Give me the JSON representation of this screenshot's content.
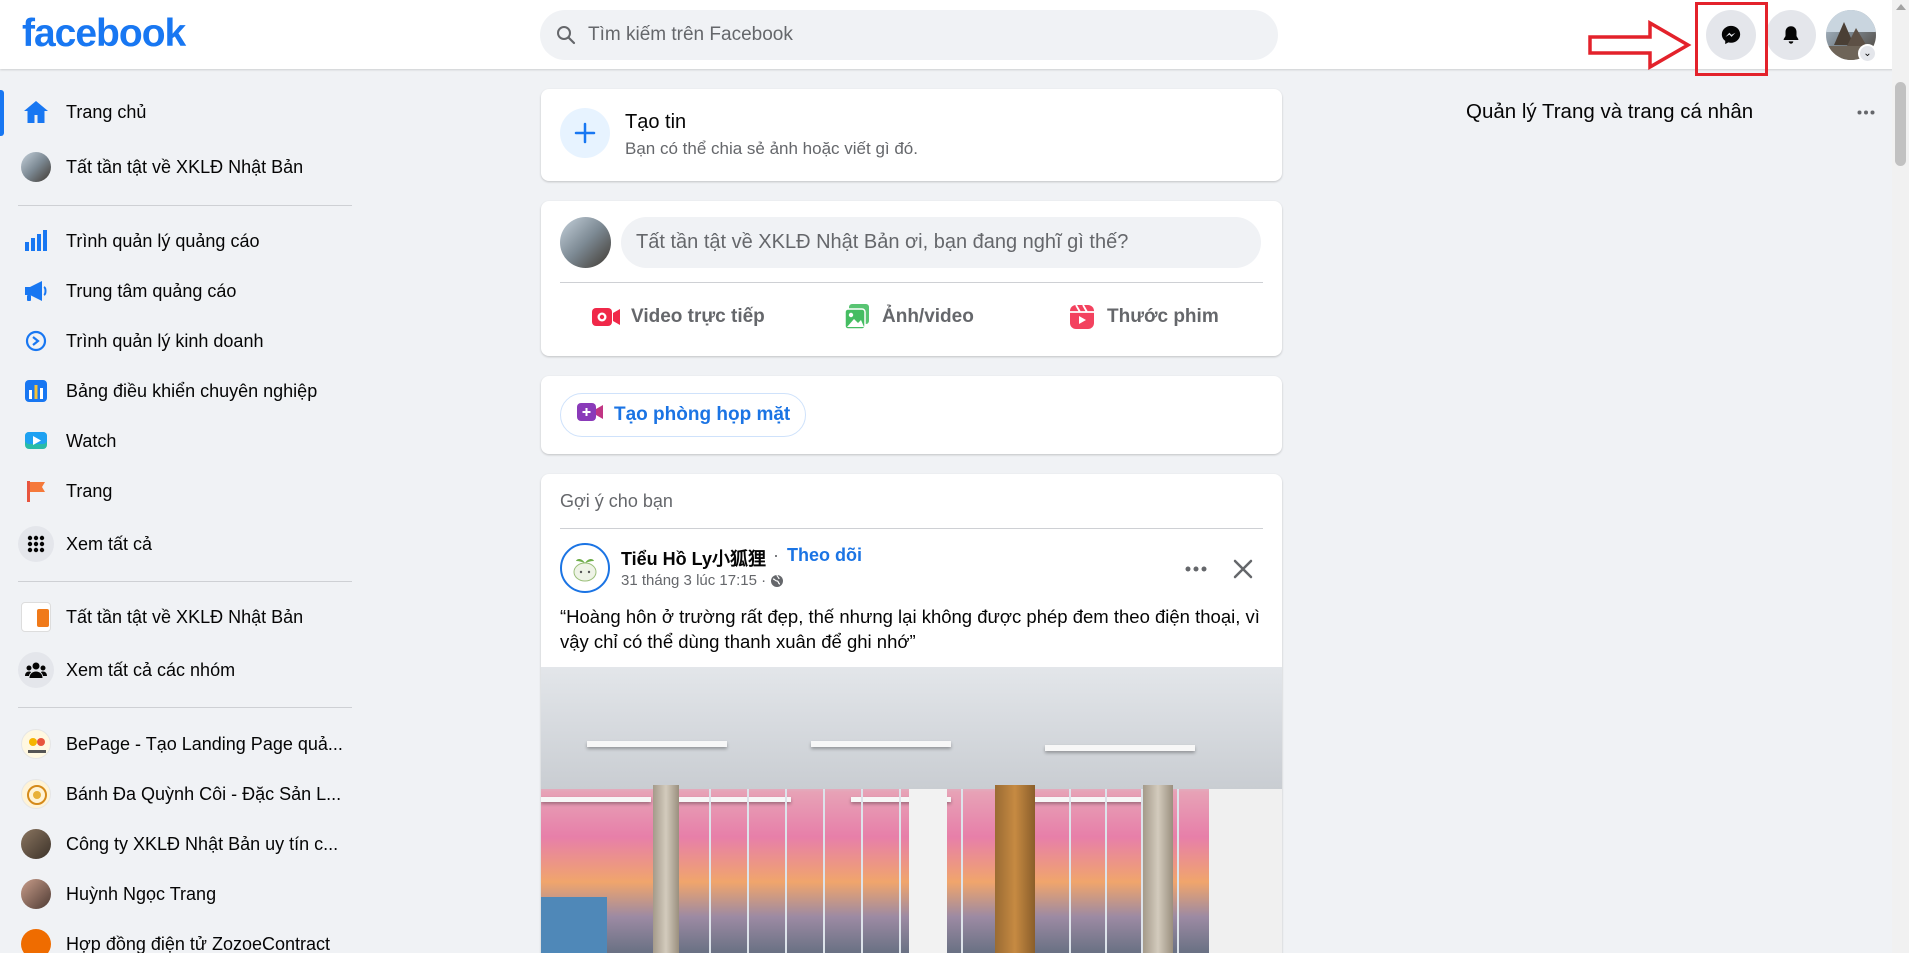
{
  "header": {
    "logo": "facebook",
    "search_placeholder": "Tìm kiếm trên Facebook",
    "icons": [
      "messenger-icon",
      "notification-bell-icon",
      "profile-avatar"
    ]
  },
  "sidebar": {
    "items": [
      {
        "label": "Trang chủ",
        "icon": "home-icon",
        "active": true
      },
      {
        "label": "Tất tần tật về XKLĐ Nhật Bản",
        "icon": "profile-avatar"
      },
      {
        "label": "Trình quản lý quảng cáo",
        "icon": "ads-manager-icon"
      },
      {
        "label": "Trung tâm quảng cáo",
        "icon": "megaphone-icon"
      },
      {
        "label": "Trình quản lý kinh doanh",
        "icon": "business-manager-icon"
      },
      {
        "label": "Bảng điều khiển chuyên nghiệp",
        "icon": "dashboard-icon"
      },
      {
        "label": "Watch",
        "icon": "watch-icon"
      },
      {
        "label": "Trang",
        "icon": "flag-icon"
      },
      {
        "label": "Xem tất cả",
        "icon": "grid-icon"
      },
      {
        "label": "Tất tần tật về XKLĐ Nhật Bản",
        "icon": "group-avatar"
      },
      {
        "label": "Xem tất cả các nhóm",
        "icon": "groups-icon"
      },
      {
        "label": "BePage - Tạo Landing Page quả...",
        "icon": "page-avatar"
      },
      {
        "label": "Bánh Đa Quỳnh Côi - Đặc Sản L...",
        "icon": "page-avatar"
      },
      {
        "label": "Công ty XKLĐ Nhật Bản uy tín c...",
        "icon": "page-avatar"
      },
      {
        "label": "Huỳnh Ngọc Trang",
        "icon": "profile-avatar"
      },
      {
        "label": "Hợp đồng điện tử ZozoeContract",
        "icon": "page-avatar"
      }
    ]
  },
  "feed": {
    "create_story": {
      "title": "Tạo tin",
      "subtitle": "Bạn có thể chia sẻ ảnh hoặc viết gì đó."
    },
    "composer": {
      "placeholder": "Tất tần tật về XKLĐ Nhật Bản ơi, bạn đang nghĩ gì thế?",
      "actions": [
        "Video trực tiếp",
        "Ảnh/video",
        "Thước phim"
      ]
    },
    "room": {
      "label": "Tạo phòng họp mặt"
    },
    "suggestion": {
      "header": "Gợi ý cho bạn",
      "author": "Tiểu Hồ Ly小狐狸",
      "separator": "·",
      "follow": "Theo dõi",
      "time": "31 tháng 3 lúc 17:15 ·",
      "text": "“Hoàng hôn ở trường rất đẹp, thế nhưng lại không được phép đem theo điện thoại, vì vậy chỉ có thể dùng thanh xuân để ghi nhớ”"
    }
  },
  "right": {
    "title": "Quản lý Trang và trang cá nhân"
  },
  "colors": {
    "brand": "#1877f2",
    "highlight": "#e3222b",
    "background": "#f0f2f5"
  }
}
